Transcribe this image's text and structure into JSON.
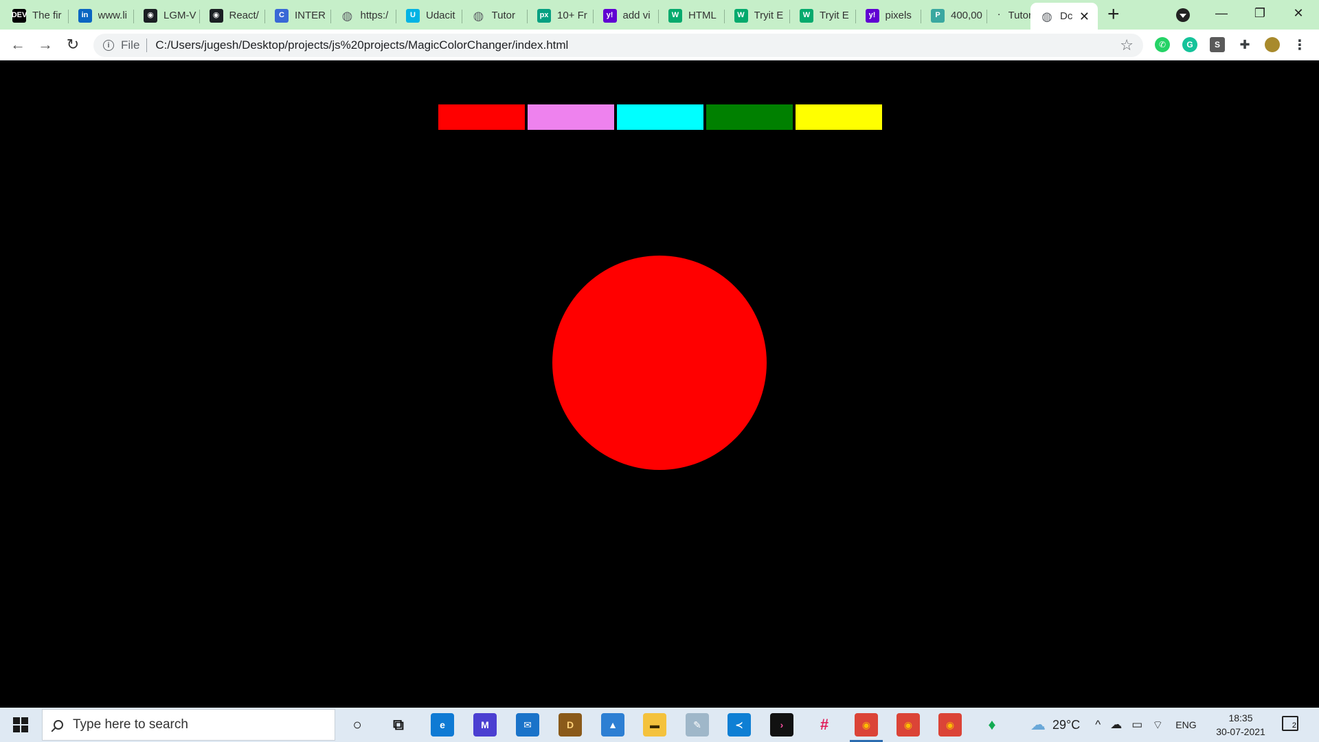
{
  "browser": {
    "tabs": [
      {
        "title": "The fir",
        "icon": "dev-icon",
        "glyph": "DEV",
        "color": "#000000"
      },
      {
        "title": "www.li",
        "icon": "linkedin-icon",
        "glyph": "in",
        "color": "#0a66c2"
      },
      {
        "title": "LGM-V",
        "icon": "github-icon",
        "glyph": "◉",
        "color": "#1b1f23"
      },
      {
        "title": "React/",
        "icon": "github-icon",
        "glyph": "◉",
        "color": "#1b1f23"
      },
      {
        "title": "INTER",
        "icon": "c-logo-icon",
        "glyph": "C",
        "color": "#3868d6"
      },
      {
        "title": "https:/",
        "icon": "globe-icon",
        "glyph": "◍",
        "color": "#5f6368"
      },
      {
        "title": "Udacit",
        "icon": "udacity-icon",
        "glyph": "U",
        "color": "#02b3e4"
      },
      {
        "title": "Tutor",
        "icon": "globe-icon",
        "glyph": "◍",
        "color": "#5f6368"
      },
      {
        "title": "10+ Fr",
        "icon": "pexels-icon",
        "glyph": "px",
        "color": "#05a081"
      },
      {
        "title": "add vi",
        "icon": "yahoo-icon",
        "glyph": "y!",
        "color": "#6001d2"
      },
      {
        "title": "HTML",
        "icon": "w3schools-icon",
        "glyph": "W",
        "color": "#04aa6d"
      },
      {
        "title": "Tryit E",
        "icon": "w3schools-icon",
        "glyph": "W",
        "color": "#04aa6d"
      },
      {
        "title": "Tryit E",
        "icon": "w3schools-icon",
        "glyph": "W",
        "color": "#04aa6d"
      },
      {
        "title": "pixels",
        "icon": "yahoo-icon",
        "glyph": "y!",
        "color": "#6001d2"
      },
      {
        "title": "400,00",
        "icon": "site-icon",
        "glyph": "P",
        "color": "#3aa8a0"
      },
      {
        "title": "Tutor",
        "icon": "dot-icon",
        "glyph": "·",
        "color": "#c6efc9"
      },
      {
        "title": "Dc",
        "icon": "globe-icon",
        "glyph": "◍",
        "color": "#5f6368",
        "active": true
      }
    ],
    "new_tab": "+",
    "tab_close": "✕",
    "window_controls": {
      "minimize": "—",
      "restore": "❐",
      "close": "✕"
    },
    "nav": {
      "back": "←",
      "forward": "→",
      "reload": "↻"
    },
    "address": {
      "info_glyph": "i",
      "scheme": "File",
      "url": "C:/Users/jugesh/Desktop/projects/js%20projects/MagicColorChanger/index.html",
      "bookmark": "☆"
    },
    "extensions": [
      {
        "name": "whatsapp-icon",
        "glyph": "✆",
        "color": "#25d366"
      },
      {
        "name": "grammarly-icon",
        "glyph": "G",
        "color": "#15c39a"
      },
      {
        "name": "s-extension-icon",
        "glyph": "S",
        "color": "#5a5a5a"
      },
      {
        "name": "puzzle-icon",
        "glyph": "✚",
        "color": "#3c4043"
      },
      {
        "name": "profile-avatar",
        "glyph": "",
        "color": "#a88a2c"
      },
      {
        "name": "menu-icon",
        "glyph": "⋮",
        "color": "#ffffff"
      }
    ]
  },
  "page": {
    "background": "#000000",
    "swatches": [
      {
        "name": "red",
        "color": "#ff0000"
      },
      {
        "name": "violet",
        "color": "#ee82ee"
      },
      {
        "name": "cyan",
        "color": "#00ffff"
      },
      {
        "name": "green",
        "color": "#008000"
      },
      {
        "name": "yellow",
        "color": "#ffff00"
      }
    ],
    "circle_color": "#ff0000"
  },
  "taskbar": {
    "search_placeholder": "Type here to search",
    "apps": [
      {
        "name": "cortana-icon",
        "glyph": "○",
        "color": "transparent",
        "text": "#111111"
      },
      {
        "name": "task-view-icon",
        "glyph": "⧉",
        "color": "transparent",
        "text": "#111111"
      },
      {
        "name": "edge-icon",
        "glyph": "e",
        "color": "#0f7ad4",
        "text": "#ffffff"
      },
      {
        "name": "app-m-icon",
        "glyph": "M",
        "color": "#4b3fd1",
        "text": "#ffffff"
      },
      {
        "name": "mail-icon",
        "glyph": "✉",
        "color": "#1a73c9",
        "text": "#ffffff"
      },
      {
        "name": "dosbox-icon",
        "glyph": "D",
        "color": "#8a5a1a",
        "text": "#ffd27a"
      },
      {
        "name": "photos-icon",
        "glyph": "▲",
        "color": "#2d7fd3",
        "text": "#ffffff"
      },
      {
        "name": "file-explorer-icon",
        "glyph": "▬",
        "color": "#f4c23d",
        "text": "#3a2a00"
      },
      {
        "name": "app-pen-icon",
        "glyph": "✎",
        "color": "#9fb7c9",
        "text": "#ffffff"
      },
      {
        "name": "vscode-icon",
        "glyph": "≺",
        "color": "#0e7fd4",
        "text": "#ffffff"
      },
      {
        "name": "terminal-icon",
        "glyph": "›",
        "color": "#111111",
        "text": "#ff4fa3"
      },
      {
        "name": "slack-icon",
        "glyph": "#",
        "color": "transparent",
        "text": "#e01e5a"
      },
      {
        "name": "chrome-icon",
        "glyph": "◉",
        "color": "#db4437",
        "text": "#fbbc05",
        "active": true
      },
      {
        "name": "chrome-icon",
        "glyph": "◉",
        "color": "#db4437",
        "text": "#fbbc05"
      },
      {
        "name": "chrome-icon",
        "glyph": "◉",
        "color": "#db4437",
        "text": "#fbbc05"
      },
      {
        "name": "mongodb-icon",
        "glyph": "♦",
        "color": "transparent",
        "text": "#13aa52"
      }
    ],
    "weather_glyph": "☁",
    "temperature": "29°C",
    "tray_glyphs": [
      "^",
      "☁",
      "▭",
      "⌔"
    ],
    "language": "ENG",
    "time": "18:35",
    "date": "30-07-2021",
    "notification_count": "2"
  }
}
